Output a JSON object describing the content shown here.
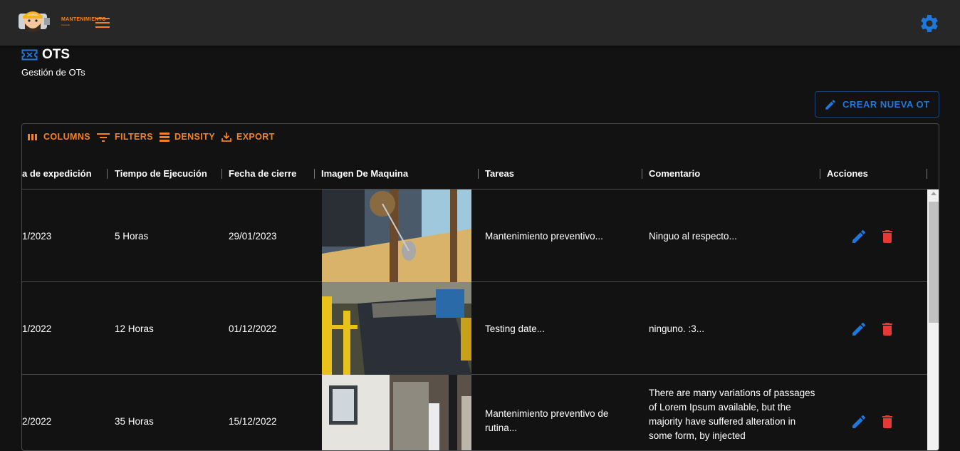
{
  "app": {
    "logo_text": "MANTENIMIENTO",
    "logo_sub": "industrial"
  },
  "header": {
    "title": "OTS",
    "subtitle": "Gestión de OTs",
    "create_button": "CREAR NUEVA OT"
  },
  "toolbar": {
    "columns": "COLUMNS",
    "filters": "FILTERS",
    "density": "DENSITY",
    "export": "EXPORT"
  },
  "table": {
    "columns": [
      "a de expedición",
      "Tiempo de Ejecución",
      "Fecha de cierre",
      "Imagen De Maquina",
      "Tareas",
      "Comentario",
      "Acciones"
    ],
    "rows": [
      {
        "expedicion": "1/2023",
        "tiempo": "5 Horas",
        "cierre": "29/01/2023",
        "tareas": "Mantenimiento preventivo...",
        "comentario": "Ninguo al respecto..."
      },
      {
        "expedicion": "1/2022",
        "tiempo": "12 Horas",
        "cierre": "01/12/2022",
        "tareas": "Testing date...",
        "comentario": "ninguno. :3..."
      },
      {
        "expedicion": "2/2022",
        "tiempo": "35 Horas",
        "cierre": "15/12/2022",
        "tareas": "Mantenimiento preventivo de rutina...",
        "comentario": "There are many variations of passages of Lorem Ipsum available, but the majority have suffered alteration in some form, by injected"
      }
    ]
  },
  "colors": {
    "accent_orange": "#f58220",
    "primary_blue": "#1e78dc",
    "delete_red": "#e53935",
    "appbar": "#272727",
    "background": "#121212"
  },
  "icons": [
    "logo-image",
    "menu-icon",
    "settings-gear-icon",
    "ticket-icon",
    "pencil-icon",
    "columns-icon",
    "filter-icon",
    "density-icon",
    "export-icon",
    "edit-icon",
    "delete-icon"
  ]
}
